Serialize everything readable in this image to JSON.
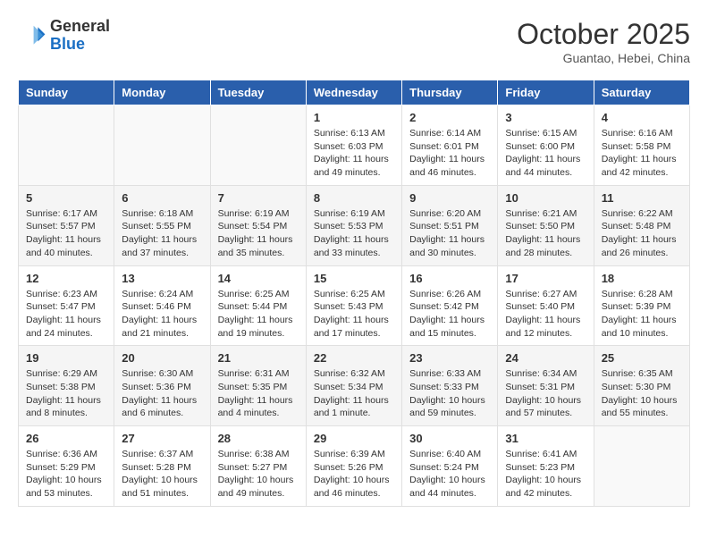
{
  "header": {
    "logo_line1": "General",
    "logo_line2": "Blue",
    "month": "October 2025",
    "location": "Guantao, Hebei, China"
  },
  "days_of_week": [
    "Sunday",
    "Monday",
    "Tuesday",
    "Wednesday",
    "Thursday",
    "Friday",
    "Saturday"
  ],
  "weeks": [
    [
      {
        "day": "",
        "info": ""
      },
      {
        "day": "",
        "info": ""
      },
      {
        "day": "",
        "info": ""
      },
      {
        "day": "1",
        "info": "Sunrise: 6:13 AM\nSunset: 6:03 PM\nDaylight: 11 hours\nand 49 minutes."
      },
      {
        "day": "2",
        "info": "Sunrise: 6:14 AM\nSunset: 6:01 PM\nDaylight: 11 hours\nand 46 minutes."
      },
      {
        "day": "3",
        "info": "Sunrise: 6:15 AM\nSunset: 6:00 PM\nDaylight: 11 hours\nand 44 minutes."
      },
      {
        "day": "4",
        "info": "Sunrise: 6:16 AM\nSunset: 5:58 PM\nDaylight: 11 hours\nand 42 minutes."
      }
    ],
    [
      {
        "day": "5",
        "info": "Sunrise: 6:17 AM\nSunset: 5:57 PM\nDaylight: 11 hours\nand 40 minutes."
      },
      {
        "day": "6",
        "info": "Sunrise: 6:18 AM\nSunset: 5:55 PM\nDaylight: 11 hours\nand 37 minutes."
      },
      {
        "day": "7",
        "info": "Sunrise: 6:19 AM\nSunset: 5:54 PM\nDaylight: 11 hours\nand 35 minutes."
      },
      {
        "day": "8",
        "info": "Sunrise: 6:19 AM\nSunset: 5:53 PM\nDaylight: 11 hours\nand 33 minutes."
      },
      {
        "day": "9",
        "info": "Sunrise: 6:20 AM\nSunset: 5:51 PM\nDaylight: 11 hours\nand 30 minutes."
      },
      {
        "day": "10",
        "info": "Sunrise: 6:21 AM\nSunset: 5:50 PM\nDaylight: 11 hours\nand 28 minutes."
      },
      {
        "day": "11",
        "info": "Sunrise: 6:22 AM\nSunset: 5:48 PM\nDaylight: 11 hours\nand 26 minutes."
      }
    ],
    [
      {
        "day": "12",
        "info": "Sunrise: 6:23 AM\nSunset: 5:47 PM\nDaylight: 11 hours\nand 24 minutes."
      },
      {
        "day": "13",
        "info": "Sunrise: 6:24 AM\nSunset: 5:46 PM\nDaylight: 11 hours\nand 21 minutes."
      },
      {
        "day": "14",
        "info": "Sunrise: 6:25 AM\nSunset: 5:44 PM\nDaylight: 11 hours\nand 19 minutes."
      },
      {
        "day": "15",
        "info": "Sunrise: 6:25 AM\nSunset: 5:43 PM\nDaylight: 11 hours\nand 17 minutes."
      },
      {
        "day": "16",
        "info": "Sunrise: 6:26 AM\nSunset: 5:42 PM\nDaylight: 11 hours\nand 15 minutes."
      },
      {
        "day": "17",
        "info": "Sunrise: 6:27 AM\nSunset: 5:40 PM\nDaylight: 11 hours\nand 12 minutes."
      },
      {
        "day": "18",
        "info": "Sunrise: 6:28 AM\nSunset: 5:39 PM\nDaylight: 11 hours\nand 10 minutes."
      }
    ],
    [
      {
        "day": "19",
        "info": "Sunrise: 6:29 AM\nSunset: 5:38 PM\nDaylight: 11 hours\nand 8 minutes."
      },
      {
        "day": "20",
        "info": "Sunrise: 6:30 AM\nSunset: 5:36 PM\nDaylight: 11 hours\nand 6 minutes."
      },
      {
        "day": "21",
        "info": "Sunrise: 6:31 AM\nSunset: 5:35 PM\nDaylight: 11 hours\nand 4 minutes."
      },
      {
        "day": "22",
        "info": "Sunrise: 6:32 AM\nSunset: 5:34 PM\nDaylight: 11 hours\nand 1 minute."
      },
      {
        "day": "23",
        "info": "Sunrise: 6:33 AM\nSunset: 5:33 PM\nDaylight: 10 hours\nand 59 minutes."
      },
      {
        "day": "24",
        "info": "Sunrise: 6:34 AM\nSunset: 5:31 PM\nDaylight: 10 hours\nand 57 minutes."
      },
      {
        "day": "25",
        "info": "Sunrise: 6:35 AM\nSunset: 5:30 PM\nDaylight: 10 hours\nand 55 minutes."
      }
    ],
    [
      {
        "day": "26",
        "info": "Sunrise: 6:36 AM\nSunset: 5:29 PM\nDaylight: 10 hours\nand 53 minutes."
      },
      {
        "day": "27",
        "info": "Sunrise: 6:37 AM\nSunset: 5:28 PM\nDaylight: 10 hours\nand 51 minutes."
      },
      {
        "day": "28",
        "info": "Sunrise: 6:38 AM\nSunset: 5:27 PM\nDaylight: 10 hours\nand 49 minutes."
      },
      {
        "day": "29",
        "info": "Sunrise: 6:39 AM\nSunset: 5:26 PM\nDaylight: 10 hours\nand 46 minutes."
      },
      {
        "day": "30",
        "info": "Sunrise: 6:40 AM\nSunset: 5:24 PM\nDaylight: 10 hours\nand 44 minutes."
      },
      {
        "day": "31",
        "info": "Sunrise: 6:41 AM\nSunset: 5:23 PM\nDaylight: 10 hours\nand 42 minutes."
      },
      {
        "day": "",
        "info": ""
      }
    ]
  ]
}
